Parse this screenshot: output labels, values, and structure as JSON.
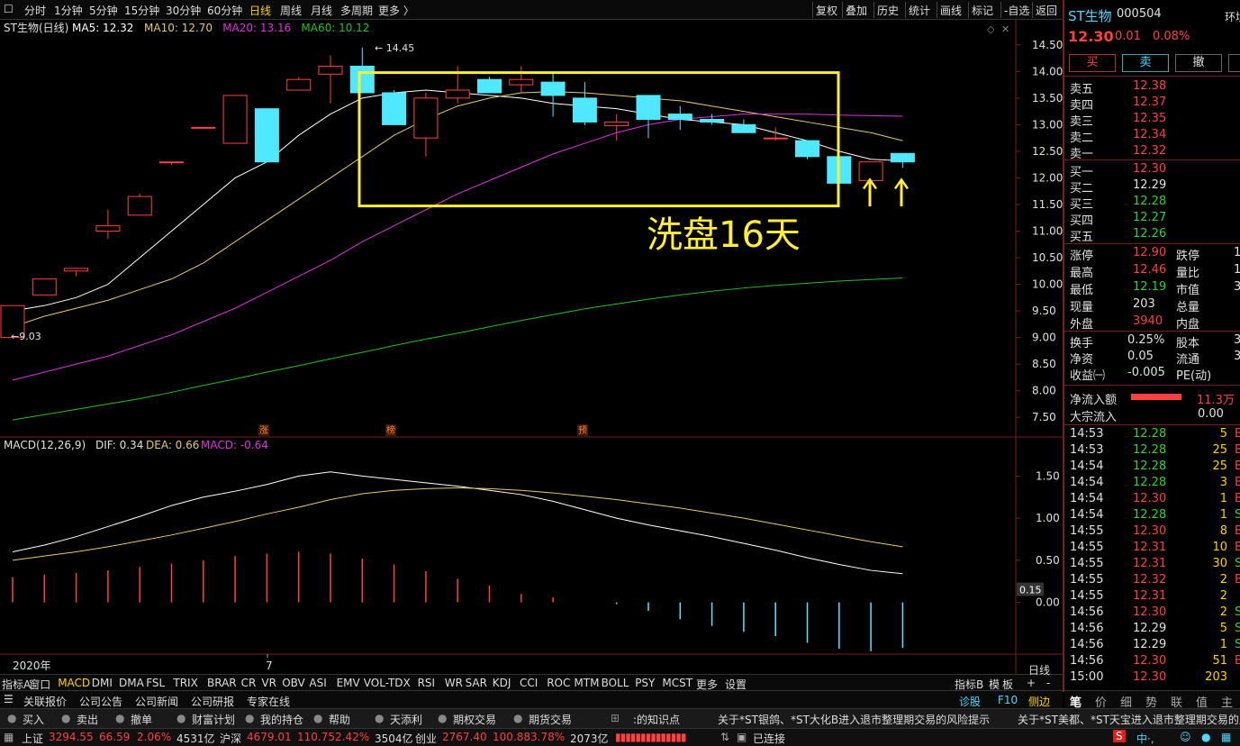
{
  "topbar": {
    "periods": [
      "分时",
      "1分钟",
      "5分钟",
      "15分钟",
      "30分钟",
      "60分钟",
      "日线",
      "周线",
      "月线",
      "多周期",
      "更多 〉"
    ],
    "active": "日线",
    "right": [
      "复权",
      "叠加",
      "历史",
      "统计",
      "画线",
      "标记",
      "-自选",
      "返回"
    ]
  },
  "chart": {
    "title": "ST生物(日线)",
    "ma_labels": [
      {
        "text": "MA5: 12.32",
        "color": "#ffffff"
      },
      {
        "text": "MA10: 12.70",
        "color": "#e6c86a"
      },
      {
        "text": "MA20: 13.16",
        "color": "#e030e0"
      },
      {
        "text": "MA60: 10.12",
        "color": "#20c020"
      }
    ],
    "high_mark": "14.45",
    "low_mark": "9.03",
    "annotation": "洗盘16天",
    "events": [
      "涨",
      "榜",
      "预"
    ],
    "x_labels": [
      "2020年",
      "7"
    ]
  },
  "macd": {
    "title": "MACD(12,26,9)",
    "dif": "DIF: 0.34",
    "dea": "DEA: 0.66",
    "macd": "MACD: -0.64",
    "current": "0.15"
  },
  "chart_data": [
    {
      "type": "candlestick",
      "title": "ST生物(日线)",
      "ylim": [
        7.3,
        14.7
      ],
      "y_ticks": [
        "14.50",
        "14.00",
        "13.50",
        "13.00",
        "12.50",
        "12.00",
        "11.50",
        "11.00",
        "10.50",
        "10.00",
        "9.50",
        "9.00",
        "8.50",
        "8.00",
        "7.50"
      ],
      "ohlc": [
        [
          9.0,
          9.6,
          9.03,
          9.6
        ],
        [
          9.8,
          10.1,
          9.8,
          10.1
        ],
        [
          10.25,
          10.3,
          10.15,
          10.3
        ],
        [
          11.0,
          11.4,
          10.85,
          11.1
        ],
        [
          11.3,
          11.7,
          11.3,
          11.65
        ],
        [
          12.3,
          12.3,
          12.25,
          12.3
        ],
        [
          12.95,
          12.95,
          12.95,
          12.95
        ],
        [
          12.65,
          13.55,
          12.65,
          13.55
        ],
        [
          13.3,
          13.3,
          12.3,
          12.3
        ],
        [
          13.65,
          13.9,
          13.65,
          13.85
        ],
        [
          13.95,
          14.3,
          13.4,
          14.1
        ],
        [
          14.1,
          14.45,
          14.0,
          13.6
        ],
        [
          13.6,
          13.65,
          13.0,
          13.0
        ],
        [
          12.75,
          13.6,
          12.4,
          13.5
        ],
        [
          13.5,
          14.1,
          13.4,
          13.65
        ],
        [
          13.85,
          13.9,
          13.6,
          13.6
        ],
        [
          13.75,
          14.1,
          13.6,
          13.85
        ],
        [
          13.8,
          14.0,
          13.15,
          13.55
        ],
        [
          13.5,
          13.8,
          12.99,
          13.05
        ],
        [
          12.98,
          13.2,
          12.7,
          13.05
        ],
        [
          13.55,
          13.55,
          12.75,
          13.1
        ],
        [
          13.2,
          13.35,
          12.9,
          13.1
        ],
        [
          13.1,
          13.2,
          13.0,
          13.05
        ],
        [
          13.0,
          13.1,
          12.85,
          12.85
        ],
        [
          12.75,
          12.95,
          12.7,
          12.75
        ],
        [
          12.7,
          12.7,
          12.35,
          12.4
        ],
        [
          12.4,
          12.4,
          11.9,
          11.9
        ],
        [
          11.95,
          12.3,
          11.8,
          12.3
        ],
        [
          12.46,
          12.46,
          12.19,
          12.3
        ]
      ],
      "series": [
        {
          "name": "MA5",
          "color": "#ffffff",
          "values": [
            9.5,
            9.6,
            9.75,
            10.0,
            10.5,
            11.0,
            11.5,
            12.0,
            12.3,
            12.8,
            13.2,
            13.5,
            13.6,
            13.65,
            13.6,
            13.55,
            13.5,
            13.4,
            13.35,
            13.3,
            13.2,
            13.1,
            13.05,
            13.0,
            12.85,
            12.7,
            12.5,
            12.35,
            12.32
          ]
        },
        {
          "name": "MA10",
          "color": "#e6c86a",
          "values": [
            9.2,
            9.4,
            9.55,
            9.7,
            9.9,
            10.1,
            10.4,
            10.8,
            11.2,
            11.6,
            12.0,
            12.4,
            12.8,
            13.1,
            13.35,
            13.5,
            13.6,
            13.62,
            13.6,
            13.55,
            13.5,
            13.45,
            13.35,
            13.25,
            13.15,
            13.05,
            12.95,
            12.85,
            12.7
          ]
        },
        {
          "name": "MA20",
          "color": "#e030e0",
          "values": [
            8.2,
            8.35,
            8.5,
            8.65,
            8.85,
            9.05,
            9.3,
            9.55,
            9.85,
            10.15,
            10.45,
            10.8,
            11.1,
            11.4,
            11.7,
            11.95,
            12.2,
            12.45,
            12.65,
            12.85,
            13.0,
            13.1,
            13.15,
            13.2,
            13.2,
            13.2,
            13.18,
            13.17,
            13.16
          ]
        },
        {
          "name": "MA60",
          "color": "#20c020",
          "values": [
            7.45,
            7.55,
            7.65,
            7.75,
            7.85,
            7.97,
            8.1,
            8.22,
            8.35,
            8.47,
            8.6,
            8.72,
            8.85,
            8.97,
            9.08,
            9.2,
            9.32,
            9.43,
            9.54,
            9.63,
            9.72,
            9.8,
            9.87,
            9.93,
            9.98,
            10.02,
            10.06,
            10.09,
            10.12
          ]
        }
      ]
    },
    {
      "type": "bar+line",
      "title": "MACD(12,26,9)",
      "ylim": [
        -0.55,
        1.75
      ],
      "y_ticks": [
        "1.50",
        "1.00",
        "0.50",
        "0.00"
      ],
      "histogram": [
        0.3,
        0.33,
        0.35,
        0.38,
        0.42,
        0.46,
        0.5,
        0.55,
        0.58,
        0.6,
        0.58,
        0.52,
        0.45,
        0.37,
        0.28,
        0.2,
        0.1,
        0.06,
        0.0,
        -0.02,
        -0.1,
        -0.2,
        -0.28,
        -0.35,
        -0.4,
        -0.48,
        -0.55,
        -0.58,
        -0.54
      ],
      "series": [
        {
          "name": "DIF",
          "color": "#ffffff",
          "values": [
            0.6,
            0.68,
            0.78,
            0.9,
            1.02,
            1.15,
            1.25,
            1.32,
            1.4,
            1.5,
            1.55,
            1.5,
            1.46,
            1.42,
            1.38,
            1.33,
            1.28,
            1.2,
            1.1,
            1.0,
            0.92,
            0.85,
            0.78,
            0.7,
            0.62,
            0.53,
            0.45,
            0.38,
            0.34
          ]
        },
        {
          "name": "DEA",
          "color": "#e6c86a",
          "values": [
            0.5,
            0.55,
            0.6,
            0.66,
            0.73,
            0.8,
            0.88,
            0.96,
            1.05,
            1.13,
            1.22,
            1.29,
            1.33,
            1.35,
            1.36,
            1.35,
            1.33,
            1.3,
            1.26,
            1.22,
            1.17,
            1.12,
            1.06,
            1.0,
            0.93,
            0.86,
            0.79,
            0.72,
            0.66
          ]
        }
      ]
    }
  ],
  "side": {
    "name": "ST生物",
    "code": "000504",
    "extra": "环境",
    "price": "12.30",
    "change": "0.01",
    "pct": "0.08%",
    "buttons": [
      "买",
      "卖",
      "撤",
      ""
    ],
    "asks": [
      {
        "label": "卖五",
        "price": "12.38"
      },
      {
        "label": "卖四",
        "price": "12.37"
      },
      {
        "label": "卖三",
        "price": "12.35"
      },
      {
        "label": "卖二",
        "price": "12.34"
      },
      {
        "label": "卖一",
        "price": "12.32"
      }
    ],
    "bids": [
      {
        "label": "买一",
        "price": "12.30",
        "c": "red"
      },
      {
        "label": "买二",
        "price": "12.29",
        "c": "white"
      },
      {
        "label": "买三",
        "price": "12.28",
        "c": "green"
      },
      {
        "label": "买四",
        "price": "12.27",
        "c": "green"
      },
      {
        "label": "买五",
        "price": "12.26",
        "c": "green"
      }
    ],
    "stats": [
      {
        "l": "涨停",
        "v": "12.90",
        "c": "red",
        "r": "跌停",
        "rv": "1"
      },
      {
        "l": "最高",
        "v": "12.46",
        "c": "red",
        "r": "量比",
        "rv": "1"
      },
      {
        "l": "最低",
        "v": "12.19",
        "c": "green",
        "r": "市值",
        "rv": "3"
      },
      {
        "l": "现量",
        "v": "203",
        "c": "white",
        "r": "总量",
        "rv": ""
      },
      {
        "l": "外盘",
        "v": "3940",
        "c": "red",
        "r": "内盘",
        "rv": ""
      }
    ],
    "stats2": [
      {
        "l": "换手",
        "v": "0.25%",
        "r": "股本",
        "rv": "3"
      },
      {
        "l": "净资",
        "v": "0.05",
        "r": "流通",
        "rv": "3"
      },
      {
        "l": "收益㈠",
        "v": "-0.005",
        "r": "PE(动)",
        "rv": ""
      }
    ],
    "flow": {
      "l1": "净流入额",
      "v1": "11.3万",
      "l2": "大宗流入",
      "v2": "0.00"
    },
    "ticks": [
      [
        "14:53",
        "12.28",
        "5",
        "B"
      ],
      [
        "14:53",
        "12.28",
        "25",
        "B"
      ],
      [
        "14:54",
        "12.28",
        "25",
        "B"
      ],
      [
        "14:54",
        "12.28",
        "3",
        "B"
      ],
      [
        "14:54",
        "12.30",
        "1",
        "B"
      ],
      [
        "14:54",
        "12.28",
        "1",
        "S"
      ],
      [
        "14:55",
        "12.30",
        "8",
        "B"
      ],
      [
        "14:55",
        "12.31",
        "10",
        "B"
      ],
      [
        "14:55",
        "12.31",
        "30",
        "S"
      ],
      [
        "14:55",
        "12.32",
        "2",
        "B"
      ],
      [
        "14:55",
        "12.31",
        "2",
        ""
      ],
      [
        "14:56",
        "12.30",
        "2",
        "S"
      ],
      [
        "14:56",
        "12.29",
        "5",
        "S"
      ],
      [
        "14:56",
        "12.29",
        "1",
        "S"
      ],
      [
        "14:56",
        "12.30",
        "51",
        "B"
      ],
      [
        "15:00",
        "12.30",
        "203",
        ""
      ]
    ],
    "bottom_tabs": [
      "笔",
      "价",
      "细",
      "势",
      "联",
      "值",
      "主"
    ]
  },
  "indtabs": [
    "指标A",
    "窗口",
    "MACD",
    "DMI",
    "DMA",
    "FSL",
    "TRIX",
    "BRAR",
    "CR",
    "VR",
    "OBV",
    "ASI",
    "EMV",
    "VOL-TDX",
    "RSI",
    "WR",
    "SAR",
    "KDJ",
    "CCI",
    "ROC",
    "MTM",
    "BOLL",
    "PSY",
    "MCST",
    "更多",
    "设置"
  ],
  "indtabs_right": [
    "指标B",
    "模",
    "板",
    "日线",
    "+",
    "-"
  ],
  "infotabs": [
    "关联报价",
    "公司公告",
    "公司新闻",
    "公司研报",
    "专家在线"
  ],
  "infotabs_right": [
    "诊股",
    "F10",
    "侧边"
  ],
  "toolbar": [
    "买入",
    "卖出",
    "撤单",
    "财富计划",
    "我的持仓",
    "帮助",
    "天添利",
    "期权交易",
    "期货交易"
  ],
  "toolbar_news": [
    ":的知识点",
    "关于*ST银鸽、*ST大化B进入退市整理期交易的风险提示",
    "关于*ST美都、*ST天宝进入退市整理期交易的风"
  ],
  "status": [
    {
      "n": "上证",
      "v": "3294.55",
      "c": "66.59",
      "p": "2.06%",
      "a": "4531亿"
    },
    {
      "n": "沪深",
      "v": "4679.01",
      "c": "110.75",
      "p": "2.42%",
      "a": "3504亿"
    },
    {
      "n": "创业",
      "v": "2767.40",
      "c": "100.88",
      "p": "3.78%",
      "a": "2073亿"
    }
  ],
  "status_conn": "已连接"
}
